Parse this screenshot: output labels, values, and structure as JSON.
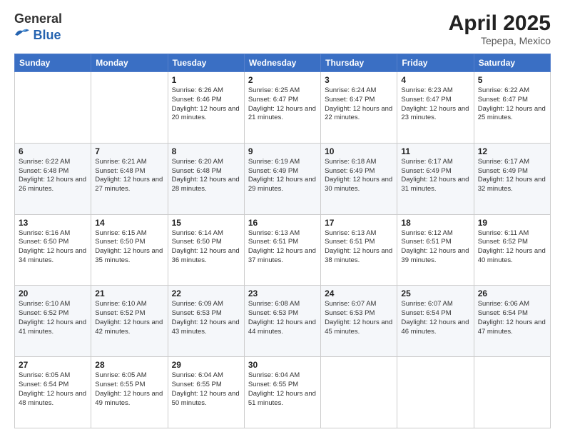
{
  "header": {
    "logo_general": "General",
    "logo_blue": "Blue",
    "month_title": "April 2025",
    "subtitle": "Tepepa, Mexico"
  },
  "days_of_week": [
    "Sunday",
    "Monday",
    "Tuesday",
    "Wednesday",
    "Thursday",
    "Friday",
    "Saturday"
  ],
  "weeks": [
    [
      {
        "day": "",
        "empty": true
      },
      {
        "day": "",
        "empty": true
      },
      {
        "day": "1",
        "sunrise": "Sunrise: 6:26 AM",
        "sunset": "Sunset: 6:46 PM",
        "daylight": "Daylight: 12 hours and 20 minutes."
      },
      {
        "day": "2",
        "sunrise": "Sunrise: 6:25 AM",
        "sunset": "Sunset: 6:47 PM",
        "daylight": "Daylight: 12 hours and 21 minutes."
      },
      {
        "day": "3",
        "sunrise": "Sunrise: 6:24 AM",
        "sunset": "Sunset: 6:47 PM",
        "daylight": "Daylight: 12 hours and 22 minutes."
      },
      {
        "day": "4",
        "sunrise": "Sunrise: 6:23 AM",
        "sunset": "Sunset: 6:47 PM",
        "daylight": "Daylight: 12 hours and 23 minutes."
      },
      {
        "day": "5",
        "sunrise": "Sunrise: 6:22 AM",
        "sunset": "Sunset: 6:47 PM",
        "daylight": "Daylight: 12 hours and 25 minutes."
      }
    ],
    [
      {
        "day": "6",
        "sunrise": "Sunrise: 6:22 AM",
        "sunset": "Sunset: 6:48 PM",
        "daylight": "Daylight: 12 hours and 26 minutes."
      },
      {
        "day": "7",
        "sunrise": "Sunrise: 6:21 AM",
        "sunset": "Sunset: 6:48 PM",
        "daylight": "Daylight: 12 hours and 27 minutes."
      },
      {
        "day": "8",
        "sunrise": "Sunrise: 6:20 AM",
        "sunset": "Sunset: 6:48 PM",
        "daylight": "Daylight: 12 hours and 28 minutes."
      },
      {
        "day": "9",
        "sunrise": "Sunrise: 6:19 AM",
        "sunset": "Sunset: 6:49 PM",
        "daylight": "Daylight: 12 hours and 29 minutes."
      },
      {
        "day": "10",
        "sunrise": "Sunrise: 6:18 AM",
        "sunset": "Sunset: 6:49 PM",
        "daylight": "Daylight: 12 hours and 30 minutes."
      },
      {
        "day": "11",
        "sunrise": "Sunrise: 6:17 AM",
        "sunset": "Sunset: 6:49 PM",
        "daylight": "Daylight: 12 hours and 31 minutes."
      },
      {
        "day": "12",
        "sunrise": "Sunrise: 6:17 AM",
        "sunset": "Sunset: 6:49 PM",
        "daylight": "Daylight: 12 hours and 32 minutes."
      }
    ],
    [
      {
        "day": "13",
        "sunrise": "Sunrise: 6:16 AM",
        "sunset": "Sunset: 6:50 PM",
        "daylight": "Daylight: 12 hours and 34 minutes."
      },
      {
        "day": "14",
        "sunrise": "Sunrise: 6:15 AM",
        "sunset": "Sunset: 6:50 PM",
        "daylight": "Daylight: 12 hours and 35 minutes."
      },
      {
        "day": "15",
        "sunrise": "Sunrise: 6:14 AM",
        "sunset": "Sunset: 6:50 PM",
        "daylight": "Daylight: 12 hours and 36 minutes."
      },
      {
        "day": "16",
        "sunrise": "Sunrise: 6:13 AM",
        "sunset": "Sunset: 6:51 PM",
        "daylight": "Daylight: 12 hours and 37 minutes."
      },
      {
        "day": "17",
        "sunrise": "Sunrise: 6:13 AM",
        "sunset": "Sunset: 6:51 PM",
        "daylight": "Daylight: 12 hours and 38 minutes."
      },
      {
        "day": "18",
        "sunrise": "Sunrise: 6:12 AM",
        "sunset": "Sunset: 6:51 PM",
        "daylight": "Daylight: 12 hours and 39 minutes."
      },
      {
        "day": "19",
        "sunrise": "Sunrise: 6:11 AM",
        "sunset": "Sunset: 6:52 PM",
        "daylight": "Daylight: 12 hours and 40 minutes."
      }
    ],
    [
      {
        "day": "20",
        "sunrise": "Sunrise: 6:10 AM",
        "sunset": "Sunset: 6:52 PM",
        "daylight": "Daylight: 12 hours and 41 minutes."
      },
      {
        "day": "21",
        "sunrise": "Sunrise: 6:10 AM",
        "sunset": "Sunset: 6:52 PM",
        "daylight": "Daylight: 12 hours and 42 minutes."
      },
      {
        "day": "22",
        "sunrise": "Sunrise: 6:09 AM",
        "sunset": "Sunset: 6:53 PM",
        "daylight": "Daylight: 12 hours and 43 minutes."
      },
      {
        "day": "23",
        "sunrise": "Sunrise: 6:08 AM",
        "sunset": "Sunset: 6:53 PM",
        "daylight": "Daylight: 12 hours and 44 minutes."
      },
      {
        "day": "24",
        "sunrise": "Sunrise: 6:07 AM",
        "sunset": "Sunset: 6:53 PM",
        "daylight": "Daylight: 12 hours and 45 minutes."
      },
      {
        "day": "25",
        "sunrise": "Sunrise: 6:07 AM",
        "sunset": "Sunset: 6:54 PM",
        "daylight": "Daylight: 12 hours and 46 minutes."
      },
      {
        "day": "26",
        "sunrise": "Sunrise: 6:06 AM",
        "sunset": "Sunset: 6:54 PM",
        "daylight": "Daylight: 12 hours and 47 minutes."
      }
    ],
    [
      {
        "day": "27",
        "sunrise": "Sunrise: 6:05 AM",
        "sunset": "Sunset: 6:54 PM",
        "daylight": "Daylight: 12 hours and 48 minutes."
      },
      {
        "day": "28",
        "sunrise": "Sunrise: 6:05 AM",
        "sunset": "Sunset: 6:55 PM",
        "daylight": "Daylight: 12 hours and 49 minutes."
      },
      {
        "day": "29",
        "sunrise": "Sunrise: 6:04 AM",
        "sunset": "Sunset: 6:55 PM",
        "daylight": "Daylight: 12 hours and 50 minutes."
      },
      {
        "day": "30",
        "sunrise": "Sunrise: 6:04 AM",
        "sunset": "Sunset: 6:55 PM",
        "daylight": "Daylight: 12 hours and 51 minutes."
      },
      {
        "day": "",
        "empty": true
      },
      {
        "day": "",
        "empty": true
      },
      {
        "day": "",
        "empty": true
      }
    ]
  ]
}
